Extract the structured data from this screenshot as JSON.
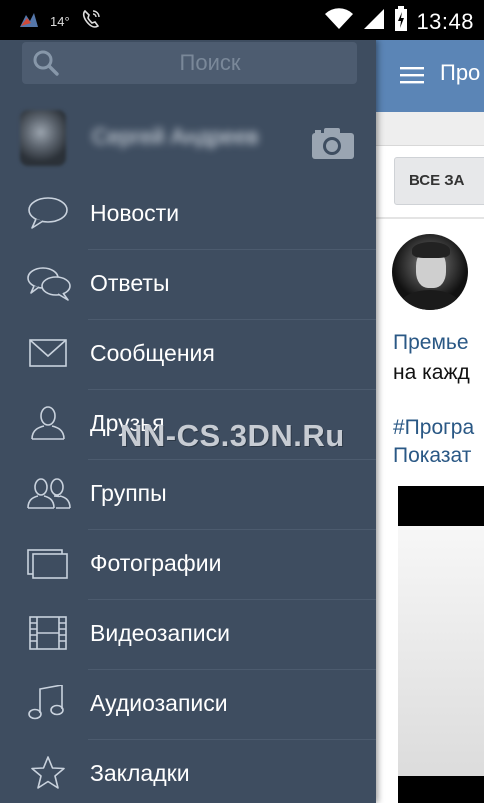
{
  "status_bar": {
    "temperature": "14°",
    "time": "13:48",
    "icons": [
      "app-notification-icon",
      "phone-icon",
      "wifi-icon",
      "signal-icon",
      "battery-charging-icon"
    ]
  },
  "drawer": {
    "search": {
      "placeholder": "Поиск",
      "value": ""
    },
    "profile": {
      "name": "Сергей Андреев",
      "camera_icon": "camera-icon"
    },
    "menu": [
      {
        "label": "Новости",
        "icon": "speech-bubble-icon"
      },
      {
        "label": "Ответы",
        "icon": "speech-bubbles-icon"
      },
      {
        "label": "Сообщения",
        "icon": "envelope-icon"
      },
      {
        "label": "Друзья",
        "icon": "person-icon"
      },
      {
        "label": "Группы",
        "icon": "group-icon"
      },
      {
        "label": "Фотографии",
        "icon": "photos-icon"
      },
      {
        "label": "Видеозаписи",
        "icon": "film-icon"
      },
      {
        "label": "Аудиозаписи",
        "icon": "music-note-icon"
      },
      {
        "label": "Закладки",
        "icon": "star-icon"
      }
    ]
  },
  "watermark": "NN-CS.3DN.Ru",
  "feed": {
    "header_title": "Про",
    "filter_button": "ВСЕ ЗА",
    "post": {
      "line1": "Премье",
      "line2": "на кажд",
      "line3": "#Програ",
      "line4": "Показат"
    }
  },
  "colors": {
    "drawer_bg": "#3e4d60",
    "header_blue": "#5b85b6",
    "link": "#2a5885"
  }
}
